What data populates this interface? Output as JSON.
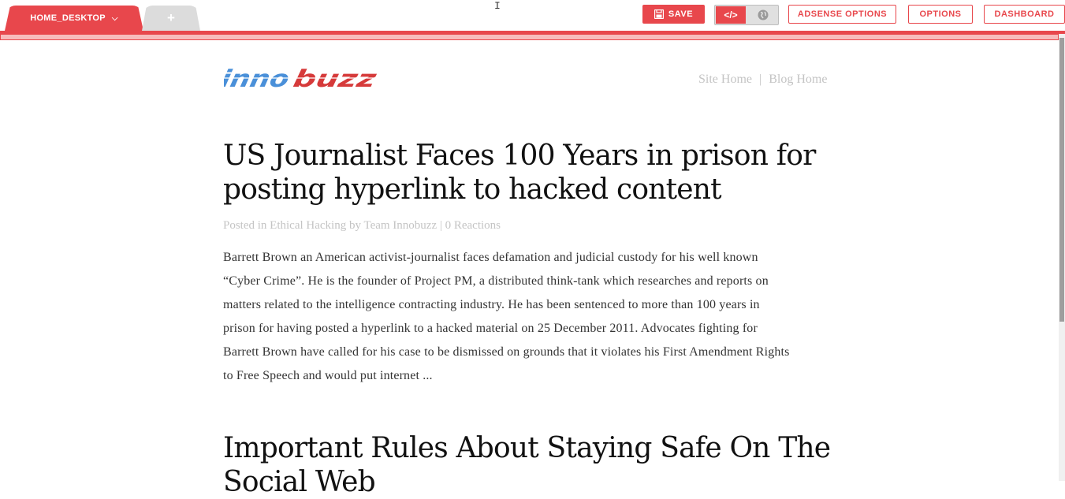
{
  "toolbar": {
    "tabs": [
      {
        "label": "HOME_DESKTOP"
      },
      {
        "label": "+"
      }
    ],
    "save_label": "SAVE",
    "adsense_label": "ADSENSE OPTIONS",
    "options_label": "OPTIONS",
    "dashboard_label": "DASHBOARD",
    "accent_color": "#e8474c"
  },
  "site": {
    "logo_text": "innobuzz",
    "nav": {
      "site_home": "Site Home",
      "separator": "|",
      "blog_home": "Blog Home"
    }
  },
  "posts": [
    {
      "title_lines": [
        "US Journalist Faces 100 Years in prison for",
        "posting hyperlink to hacked content"
      ],
      "meta": "Posted in Ethical Hacking by Team Innobuzz | 0 Reactions",
      "excerpt_lines": [
        "Barrett Brown an American activist-journalist faces defamation and judicial custody for his well known",
        "“Cyber Crime”. He is the founder of Project PM, a distributed think-tank which researches and reports on",
        "matters related to the intelligence contracting industry. He has been sentenced to more than 100 years in",
        "prison for having posted a hyperlink to a hacked material on 25 December 2011. Advocates fighting for",
        "Barrett Brown have called for his case to be dismissed on grounds that it violates his First Amendment Rights",
        "to Free Speech and would put internet ..."
      ]
    },
    {
      "title_lines": [
        "Important Rules About Staying Safe On The",
        "Social Web"
      ]
    }
  ]
}
